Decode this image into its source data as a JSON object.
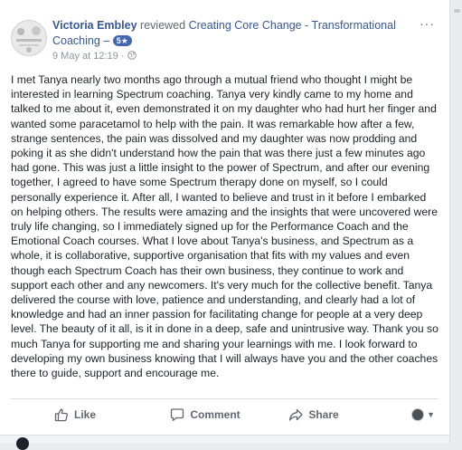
{
  "review": {
    "author": "Victoria Embley",
    "verb": "reviewed",
    "page_name": "Creating Core Change - Transformational Coaching –",
    "rating_badge": "5★",
    "date": "9 May at 12:19 ·",
    "more_label": "···",
    "body": "I met Tanya nearly two months ago through a mutual friend who thought I might be interested in learning Spectrum coaching. Tanya very kindly came to my home and talked to me about it, even demonstrated it on my daughter who had hurt her finger and wanted some paracetamol to help with the pain. It was remarkable how after a few, strange sentences, the pain was dissolved and my daughter was now prodding and poking it as she didn't understand how the pain that was there just a few minutes ago had gone. This was just a little insight to the power of Spectrum, and after our evening together, I agreed to have some Spectrum therapy done on myself, so I could personally experience it. After all, I wanted to believe and trust in it before I embarked on helping others. The results were amazing and the insights that were uncovered were truly life changing, so I immediately signed up for the Performance Coach and the Emotional Coach courses. What I love about Tanya's business, and Spectrum as a whole, it is collaborative, supportive organisation that fits with my values and even though each Spectrum Coach has their own business, they continue to work and support each other and any newcomers. It's very much for the collective benefit. Tanya delivered the course with love, patience and understanding, and clearly had a lot of knowledge and had an inner passion for facilitating change for people at a very deep level. The beauty of it all, is it in done in a deep, safe and unintrusive way. Thank you so much Tanya for supporting me and sharing your learnings with me. I look forward to developing my own business knowing that I will always have you and the other coaches there to guide, support and encourage me."
  },
  "actions": {
    "like": "Like",
    "comment": "Comment",
    "share": "Share"
  },
  "colors": {
    "link": "#365899",
    "badge": "#4267b2",
    "muted": "#606770"
  },
  "icons": [
    "avatar",
    "globe-icon",
    "like-icon",
    "comment-icon",
    "share-icon",
    "chevron-down-icon"
  ]
}
